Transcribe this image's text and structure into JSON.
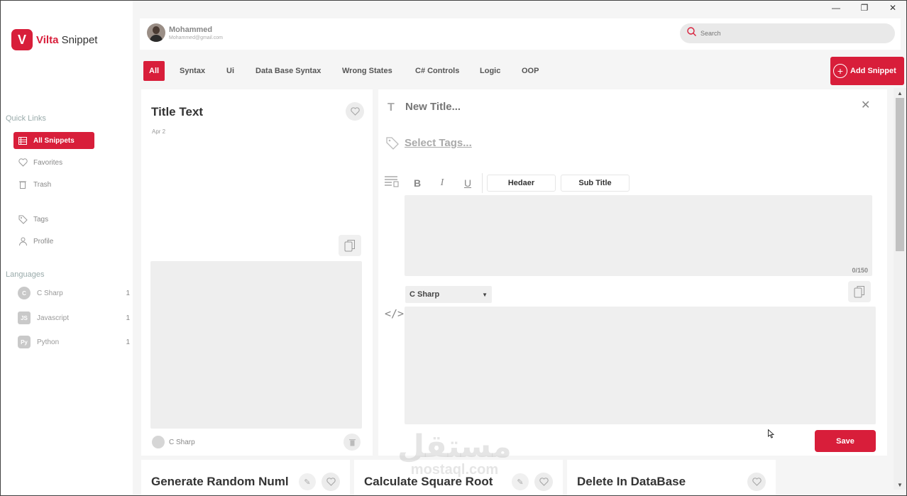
{
  "window": {
    "controls": [
      "—",
      "❐",
      "✕"
    ]
  },
  "app": {
    "logo_letter": "V",
    "logo_brand": "Vilta",
    "logo_suffix": "Snippet"
  },
  "sidebar": {
    "quick_links_title": "Quick Links",
    "items": [
      {
        "label": "All Snippets",
        "active": true
      },
      {
        "label": "Favorites"
      },
      {
        "label": "Trash"
      },
      {
        "label": "Tags"
      },
      {
        "label": "Profile"
      }
    ],
    "languages_title": "Languages",
    "languages": [
      {
        "label": "C Sharp",
        "count": "1"
      },
      {
        "label": "Javascript",
        "count": "1",
        "badge": "JS"
      },
      {
        "label": "Python",
        "count": "1"
      }
    ]
  },
  "header": {
    "user_name": "Mohammed",
    "user_email": "Mohammed@gmail.com",
    "search_placeholder": "Search"
  },
  "tabs": [
    "All",
    "Syntax",
    "Ui",
    "Data Base Syntax",
    "Wrong States",
    "C# Controls",
    "Logic",
    "OOP"
  ],
  "add_snippet_label": "Add Snippet",
  "snippet_card": {
    "title": "Title Text",
    "date": "Apr 2",
    "language": "C Sharp"
  },
  "bottom_cards": [
    {
      "title": "Generate Random Numl"
    },
    {
      "title": "Calculate Square Root"
    },
    {
      "title": "Delete In DataBase"
    }
  ],
  "editor": {
    "title_placeholder": "New Title...",
    "tags_label": "Select Tags...",
    "toolbar": {
      "bold": "B",
      "italic": "I",
      "underline": "U",
      "header_btn": "Hedaer",
      "subtitle_btn": "Sub Title"
    },
    "counter": "0/150",
    "language": "C Sharp",
    "save_label": "Save",
    "code_icon": "</>"
  },
  "watermark": {
    "arabic": "مستقل",
    "latin": "mostaql.com"
  },
  "colors": {
    "accent": "#d81e3a"
  }
}
